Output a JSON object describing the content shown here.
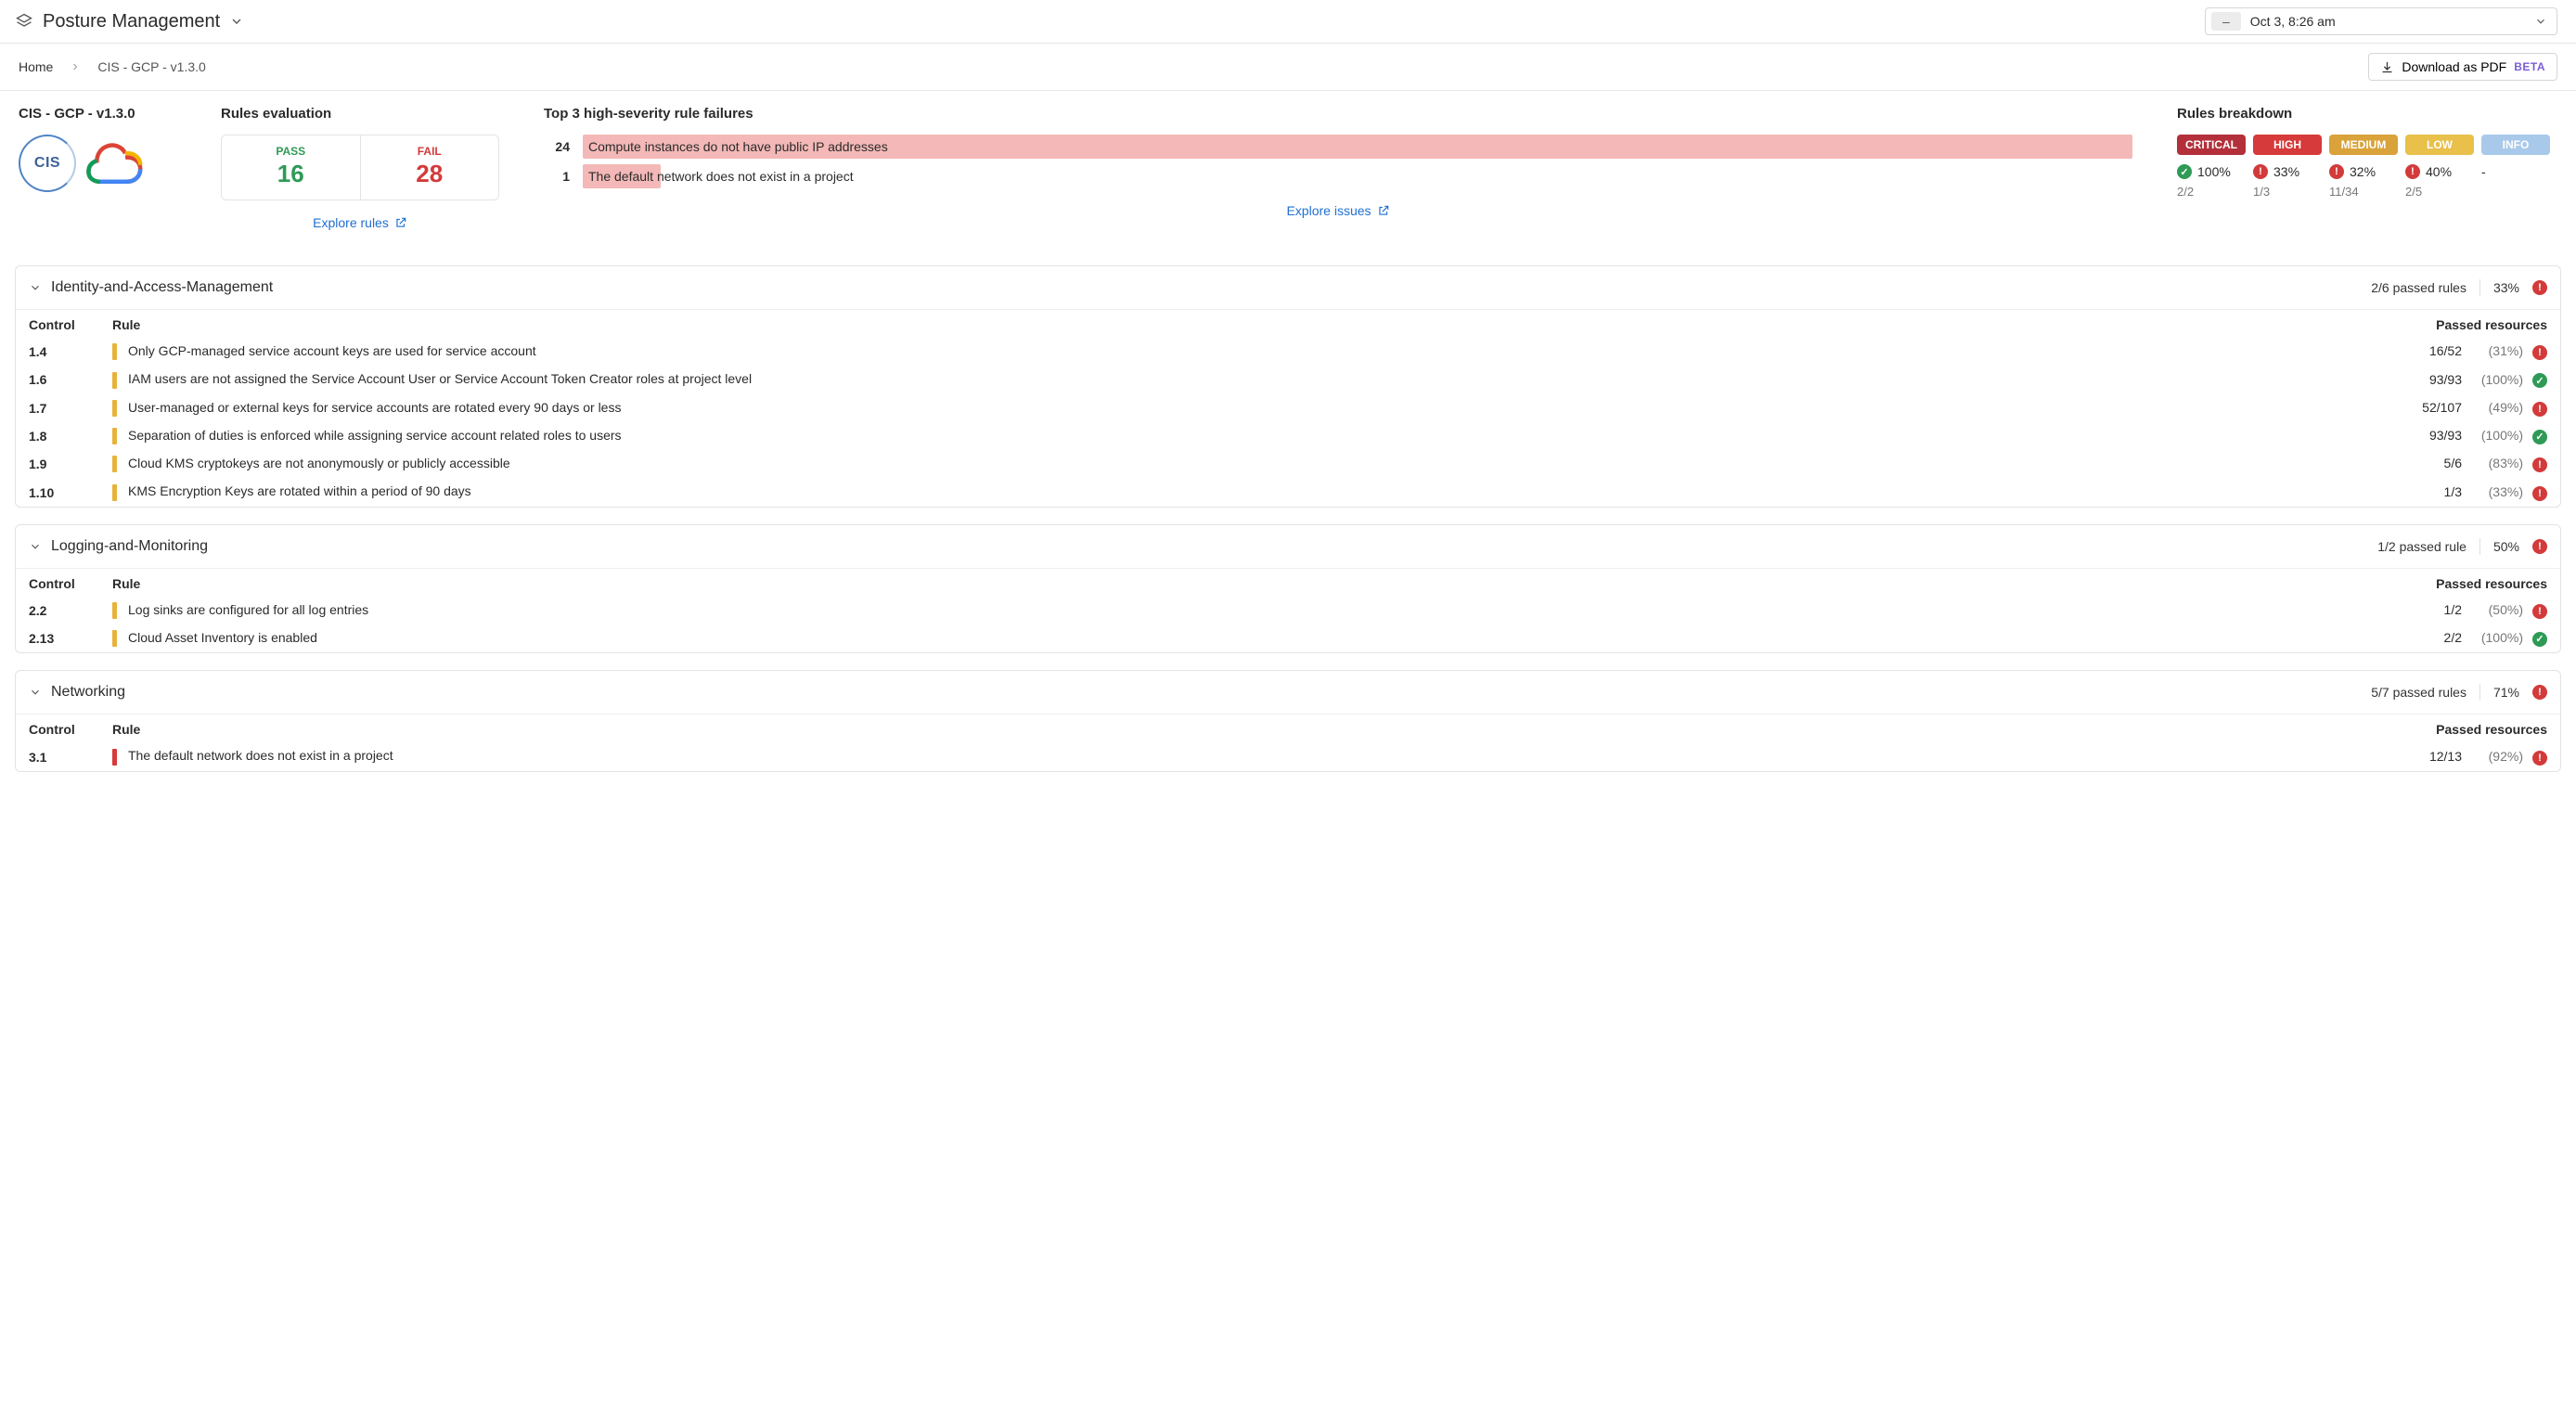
{
  "header": {
    "title": "Posture Management",
    "timeframe_label": "Oct 3, 8:26 am",
    "timeframe_pill": "–"
  },
  "breadcrumb": {
    "home": "Home",
    "current": "CIS - GCP - v1.3.0"
  },
  "download": {
    "label": "Download as PDF",
    "beta": "BETA"
  },
  "summary": {
    "framework_label": "CIS - GCP - v1.3.0",
    "cis_text": "CIS",
    "eval": {
      "heading": "Rules evaluation",
      "pass_label": "PASS",
      "pass": "16",
      "fail_label": "FAIL",
      "fail": "28",
      "explore": "Explore rules"
    },
    "top3": {
      "heading": "Top 3 high-severity rule failures",
      "rows": [
        {
          "count": "24",
          "label": "Compute instances do not have public IP addresses",
          "width_pct": 100
        },
        {
          "count": "1",
          "label": "The default network does not exist in a project",
          "width_pct": 5
        }
      ],
      "explore": "Explore issues"
    },
    "breakdown": {
      "heading": "Rules breakdown",
      "severities": [
        {
          "name": "CRITICAL",
          "cls": "critical",
          "pct": "100%",
          "ratio": "2/2",
          "ok": true
        },
        {
          "name": "HIGH",
          "cls": "high",
          "pct": "33%",
          "ratio": "1/3",
          "ok": false
        },
        {
          "name": "MEDIUM",
          "cls": "medium",
          "pct": "32%",
          "ratio": "11/34",
          "ok": false
        },
        {
          "name": "LOW",
          "cls": "low",
          "pct": "40%",
          "ratio": "2/5",
          "ok": false
        },
        {
          "name": "INFO",
          "cls": "info",
          "pct": "-",
          "ratio": "",
          "ok": null
        }
      ]
    }
  },
  "table_headers": {
    "control": "Control",
    "rule": "Rule",
    "passed": "Passed resources"
  },
  "sections": [
    {
      "title": "Identity-and-Access-Management",
      "summary_passed": "2/6 passed rules",
      "summary_pct": "33%",
      "summary_ok": false,
      "rows": [
        {
          "control": "1.4",
          "sev": "medium",
          "rule": "Only GCP-managed service account keys are used for service account",
          "ratio": "16/52",
          "pct": "(31%)",
          "ok": false
        },
        {
          "control": "1.6",
          "sev": "medium",
          "rule": "IAM users are not assigned the Service Account User or Service Account Token Creator roles at project level",
          "ratio": "93/93",
          "pct": "(100%)",
          "ok": true
        },
        {
          "control": "1.7",
          "sev": "medium",
          "rule": "User-managed or external keys for service accounts are rotated every 90 days or less",
          "ratio": "52/107",
          "pct": "(49%)",
          "ok": false
        },
        {
          "control": "1.8",
          "sev": "medium",
          "rule": "Separation of duties is enforced while assigning service account related roles to users",
          "ratio": "93/93",
          "pct": "(100%)",
          "ok": true
        },
        {
          "control": "1.9",
          "sev": "medium",
          "rule": "Cloud KMS cryptokeys are not anonymously or publicly accessible",
          "ratio": "5/6",
          "pct": "(83%)",
          "ok": false
        },
        {
          "control": "1.10",
          "sev": "medium",
          "rule": "KMS Encryption Keys are rotated within a period of 90 days",
          "ratio": "1/3",
          "pct": "(33%)",
          "ok": false
        }
      ]
    },
    {
      "title": "Logging-and-Monitoring",
      "summary_passed": "1/2 passed rule",
      "summary_pct": "50%",
      "summary_ok": false,
      "rows": [
        {
          "control": "2.2",
          "sev": "medium",
          "rule": "Log sinks are configured for all log entries",
          "ratio": "1/2",
          "pct": "(50%)",
          "ok": false
        },
        {
          "control": "2.13",
          "sev": "medium",
          "rule": "Cloud Asset Inventory is enabled",
          "ratio": "2/2",
          "pct": "(100%)",
          "ok": true
        }
      ]
    },
    {
      "title": "Networking",
      "summary_passed": "5/7 passed rules",
      "summary_pct": "71%",
      "summary_ok": false,
      "rows": [
        {
          "control": "3.1",
          "sev": "high",
          "rule": "The default network does not exist in a project",
          "ratio": "12/13",
          "pct": "(92%)",
          "ok": false
        }
      ]
    }
  ]
}
